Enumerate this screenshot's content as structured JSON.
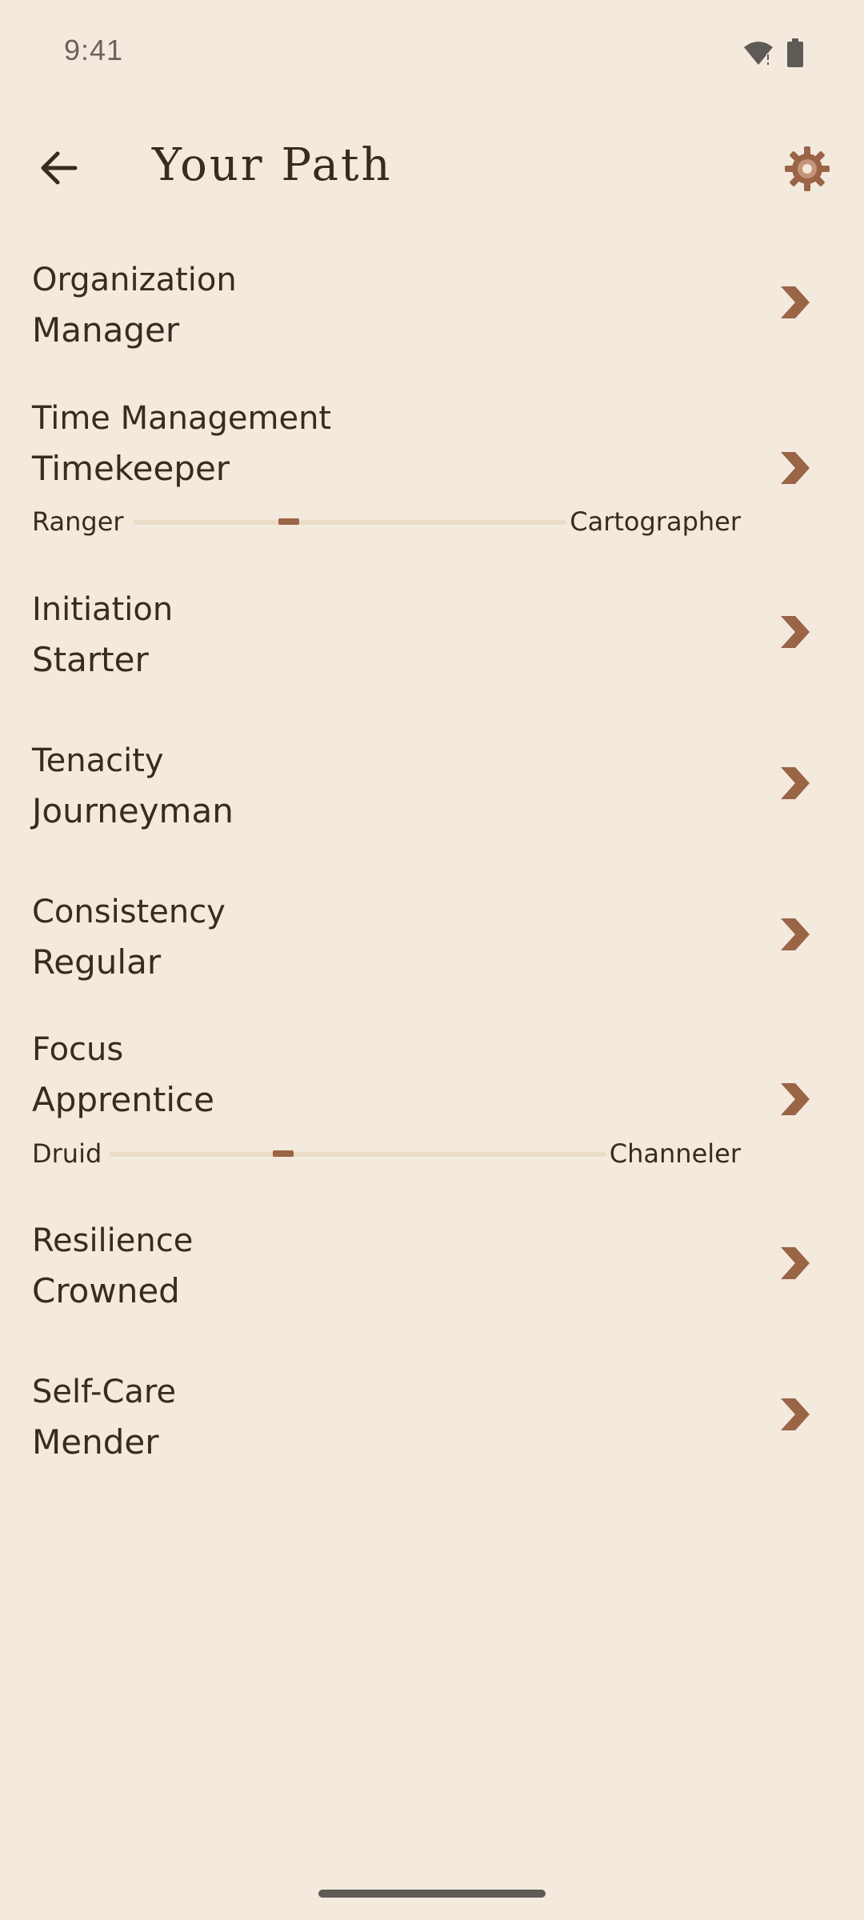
{
  "status_bar": {
    "time": "9:41",
    "icons": [
      "wifi-alert-icon",
      "battery-icon"
    ]
  },
  "app_bar": {
    "back_icon": "arrow-left-icon",
    "title": "Your Path",
    "settings_icon": "gear-icon"
  },
  "colors": {
    "background": "#F3E9DD",
    "text": "#3A2A1F",
    "accent": "#9A6446",
    "track": "#EBDCC8"
  },
  "paths": [
    {
      "category": "Organization",
      "rank": "Manager"
    },
    {
      "category": "Time Management",
      "rank": "Timekeeper",
      "progress": {
        "start": "Ranger",
        "end": "Cartographer",
        "value": 0.36
      }
    },
    {
      "category": "Initiation",
      "rank": "Starter"
    },
    {
      "category": "Tenacity",
      "rank": "Journeyman"
    },
    {
      "category": "Consistency",
      "rank": "Regular"
    },
    {
      "category": "Focus",
      "rank": "Apprentice",
      "progress": {
        "start": "Druid",
        "end": "Channeler",
        "value": 0.35
      }
    },
    {
      "category": "Resilience",
      "rank": "Crowned"
    },
    {
      "category": "Self-Care",
      "rank": "Mender"
    }
  ]
}
